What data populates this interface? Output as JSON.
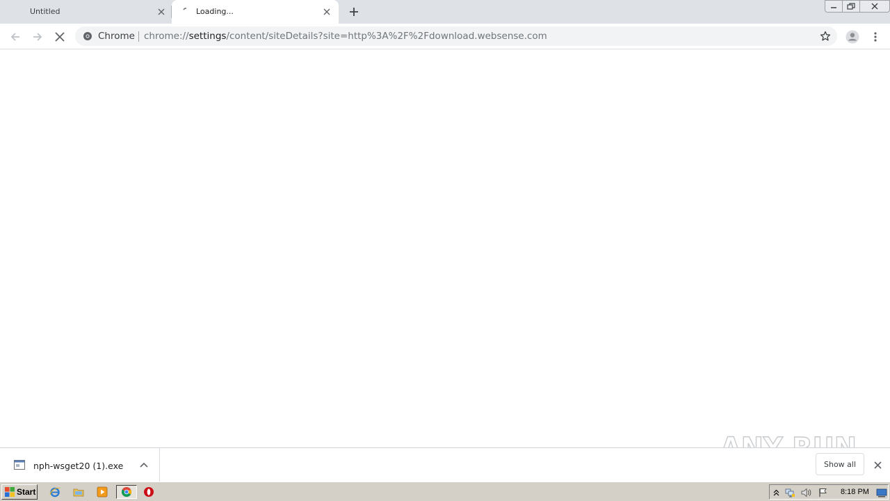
{
  "browser": {
    "tabs": [
      {
        "title": "Untitled",
        "state": "inactive"
      },
      {
        "title": "Loading...",
        "state": "active"
      }
    ],
    "toolbar": {
      "security_label": "Chrome",
      "url_scheme": "chrome://",
      "url_host": "settings",
      "url_path": "/content/siteDetails?site=http%3A%2F%2Fdownload.websense.com"
    },
    "icons": {
      "back": "arrow-left-icon",
      "forward": "arrow-right-icon",
      "stop": "stop-x-icon",
      "bookmark": "star-outline-icon",
      "profile": "account-circle-icon",
      "menu": "kebab-menu-icon"
    }
  },
  "downloads": {
    "file_name": "nph-wsget20 (1).exe",
    "show_all_label": "Show all"
  },
  "watermark": {
    "text": "ANY RUN"
  },
  "taskbar": {
    "start_label": "Start",
    "clock": "8:18 PM",
    "quick_launch": [
      "internet-explorer-icon",
      "folder-icon",
      "media-player-icon",
      "chrome-icon",
      "opera-icon"
    ]
  },
  "colors": {
    "tab_strip": "#dee1e6",
    "omnibox": "#f1f3f4",
    "taskbar": "#d4d0c8"
  }
}
